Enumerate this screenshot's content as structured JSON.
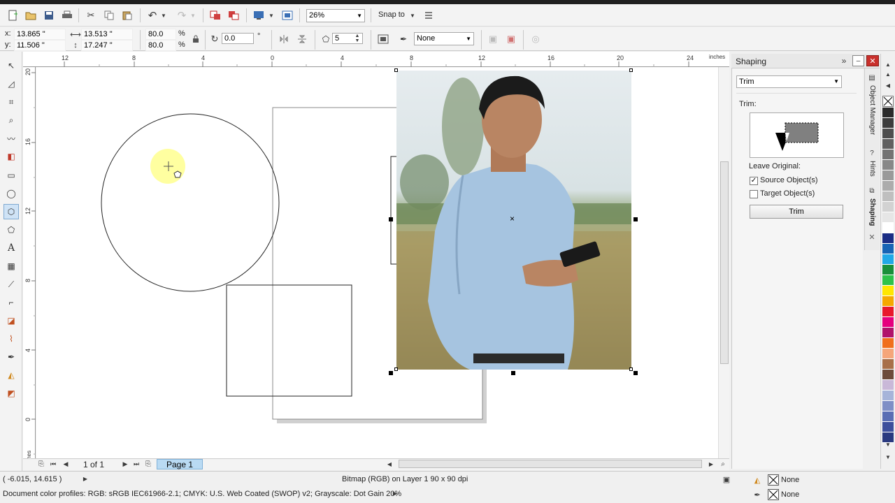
{
  "app": {
    "accent": "#3c7fb1",
    "bg": "#f0f0f0"
  },
  "standard_toolbar": {
    "zoom": "26%",
    "snap_to": "Snap to",
    "icons": [
      "new-icon",
      "open-icon",
      "save-icon",
      "print-icon",
      "cut-icon",
      "copy-icon",
      "paste-icon",
      "undo-icon",
      "redo-icon",
      "import-icon",
      "export-icon",
      "publish-icon",
      "app-launcher-icon",
      "options-icon"
    ]
  },
  "property_bar": {
    "x_label": "x:",
    "x_value": "13.865 \"",
    "y_label": "y:",
    "y_value": "11.506 \"",
    "width_value": "13.513 \"",
    "height_value": "17.247 \"",
    "scale_x": "80.0",
    "scale_y": "80.0",
    "percent": "%",
    "rotation": "0.0",
    "degree": "°",
    "sides": "5",
    "outline": "None"
  },
  "ruler": {
    "unit": "inches",
    "h_ticks": [
      "12",
      "8",
      "4",
      "0",
      "4",
      "8",
      "12",
      "16",
      "20",
      "24"
    ],
    "v_ticks": [
      "20",
      "16",
      "12",
      "8",
      "4",
      "0"
    ]
  },
  "toolbox": [
    "pick-tool-icon",
    "shape-tool-icon",
    "crop-tool-icon",
    "zoom-tool-icon",
    "freehand-tool-icon",
    "smart-fill-icon",
    "rectangle-tool-icon",
    "ellipse-tool-icon",
    "polygon-tool-icon",
    "basic-shapes-icon",
    "text-tool-icon",
    "table-tool-icon",
    "dimension-tool-icon",
    "connector-tool-icon",
    "blend-tool-icon",
    "eyedropper-tool-icon",
    "outline-pen-icon",
    "fill-tool-icon",
    "interactive-fill-icon"
  ],
  "page_nav": {
    "page_count": "1 of 1",
    "tab": "Page 1"
  },
  "shaping": {
    "title": "Shaping",
    "mode": "Trim",
    "section_label": "Trim:",
    "leave_original": "Leave Original:",
    "source_label": "Source Object(s)",
    "source_checked": true,
    "target_label": "Target Object(s)",
    "target_checked": false,
    "apply_label": "Trim"
  },
  "dockers_tabs": [
    "Object Manager",
    "Hints",
    "Shaping"
  ],
  "palette": [
    "#2b2b2b",
    "#3d3d3d",
    "#4f4f4f",
    "#616161",
    "#747474",
    "#888888",
    "#9a9a9a",
    "#acacac",
    "#bfbfbf",
    "#d2d2d2",
    "#e6e6e6",
    "#ffffff",
    "#1b2d85",
    "#1764b5",
    "#22a8e6",
    "#1a8f3a",
    "#2ec24a",
    "#ffe600",
    "#f5a800",
    "#e8182c",
    "#e5007e",
    "#b0136b",
    "#f06f1d",
    "#f5a67a",
    "#a8704a",
    "#6d4c3a",
    "#c9b8d8",
    "#a6b4d9",
    "#7f8fc6",
    "#5a6eb4",
    "#3d4f9c",
    "#2a3a80"
  ],
  "status": {
    "coords": "( -6.015, 14.615 )",
    "object_info": "Bitmap (RGB) on Layer 1 90 x 90 dpi",
    "color_profiles": "Document color profiles: RGB: sRGB IEC61966-2.1; CMYK: U.S. Web Coated (SWOP) v2; Grayscale: Dot Gain 20%",
    "fill": "None",
    "outline": "None"
  }
}
